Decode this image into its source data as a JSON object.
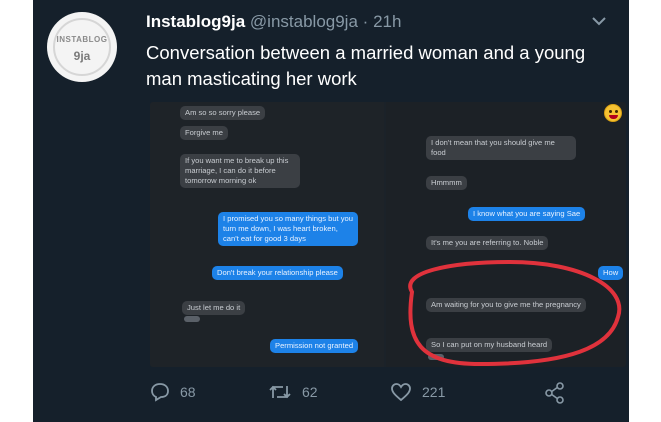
{
  "tweet": {
    "display_name": "Instablog9ja",
    "handle": "@instablog9ja",
    "separator": "·",
    "timestamp": "21h",
    "text": "Conversation between a married woman and a young man masticating her work",
    "avatar_text": "INSTABLOG",
    "avatar_mark": "9ja"
  },
  "screenshot": {
    "left_messages": [
      {
        "text": "Am so so sorry please",
        "direction": "incoming"
      },
      {
        "text": "Forgive me",
        "direction": "incoming"
      },
      {
        "text": "If you want me to break up this marriage, I can do it before tomorrow morning ok",
        "direction": "incoming"
      },
      {
        "text": "I promised you so many things but you turn me down, I was heart broken, can't eat for good 3 days",
        "direction": "outgoing"
      },
      {
        "text": "Don't break your relationship please",
        "direction": "outgoing"
      },
      {
        "text": "Just let me do it",
        "direction": "incoming"
      },
      {
        "text": "Permission not granted",
        "direction": "outgoing"
      }
    ],
    "right_messages": [
      {
        "text": "I don't mean that you should give me food",
        "direction": "incoming"
      },
      {
        "text": "Hmmmm",
        "direction": "incoming"
      },
      {
        "text": "I know what you are saying Sae",
        "direction": "outgoing"
      },
      {
        "text": "It's me you are referring to. Noble",
        "direction": "incoming"
      },
      {
        "text": "How",
        "direction": "outgoing"
      },
      {
        "text": "Am waiting for you to give me the pregnancy",
        "direction": "incoming"
      },
      {
        "text": "So I can put on my husband heard",
        "direction": "incoming"
      }
    ],
    "emoji": "grinning-face-emoji",
    "annotation_color": "#e0323c"
  },
  "actions": {
    "replies": "68",
    "retweets": "62",
    "likes": "221"
  },
  "colors": {
    "background": "#15202b",
    "secondary_text": "#8899a6",
    "outgoing_bubble": "#1d82e8",
    "incoming_bubble": "#3b3f44"
  }
}
